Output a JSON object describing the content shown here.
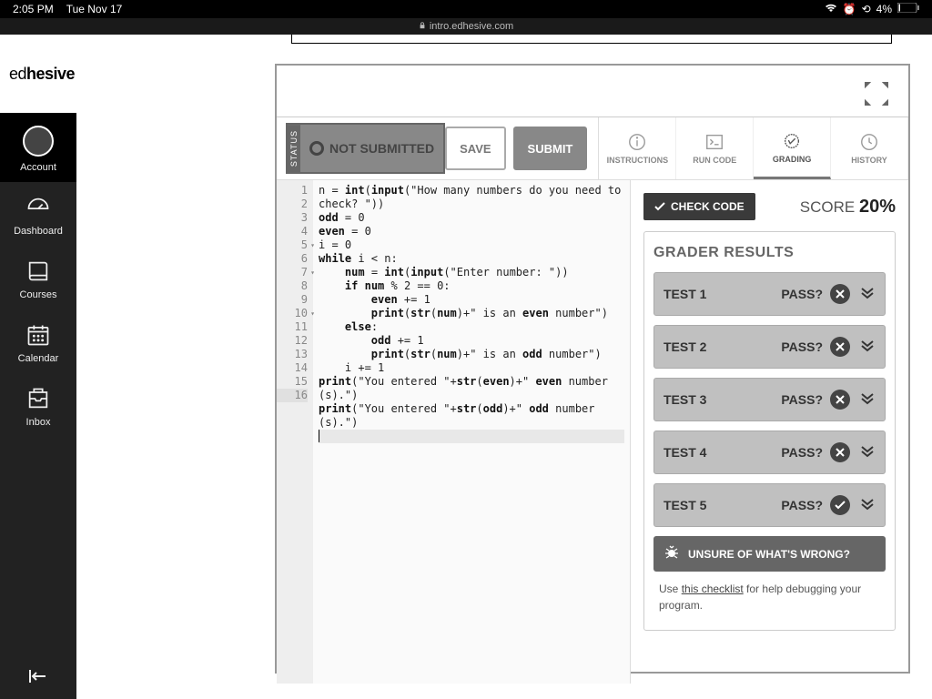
{
  "status_bar": {
    "time": "2:05 PM",
    "date": "Tue Nov 17",
    "battery": "4%"
  },
  "url_bar": {
    "host": "intro.edhesive.com"
  },
  "logo": {
    "a": "ed",
    "b": "hesive"
  },
  "sidebar": {
    "items": [
      {
        "label": "Account"
      },
      {
        "label": "Dashboard"
      },
      {
        "label": "Courses"
      },
      {
        "label": "Calendar"
      },
      {
        "label": "Inbox"
      }
    ]
  },
  "submission": {
    "status_label": "STATUS",
    "status_text": "NOT SUBMITTED",
    "save": "SAVE",
    "submit": "SUBMIT"
  },
  "tabs": {
    "instructions": "INSTRUCTIONS",
    "run": "RUN CODE",
    "grading": "GRADING",
    "history": "HISTORY"
  },
  "code": {
    "lines": [
      "n = int(input(\"How many numbers do you need to check? \"))",
      "odd = 0",
      "even = 0",
      "i = 0",
      "while i < n:",
      "    num = int(input(\"Enter number: \"))",
      "    if num % 2 == 0:",
      "        even += 1",
      "        print(str(num)+\" is an even number\")",
      "    else:",
      "        odd += 1",
      "        print(str(num)+\" is an odd number\")",
      "    i += 1",
      "print(\"You entered \"+str(even)+\" even number(s).\")",
      "print(\"You entered \"+str(odd)+\" odd number(s).\")",
      ""
    ]
  },
  "grader": {
    "check_code": "CHECK CODE",
    "score_label": "SCORE",
    "score_value": "20%",
    "results_title": "GRADER RESULTS",
    "tests": [
      {
        "name": "TEST 1",
        "label": "PASS?",
        "pass": false
      },
      {
        "name": "TEST 2",
        "label": "PASS?",
        "pass": false
      },
      {
        "name": "TEST 3",
        "label": "PASS?",
        "pass": false
      },
      {
        "name": "TEST 4",
        "label": "PASS?",
        "pass": false
      },
      {
        "name": "TEST 5",
        "label": "PASS?",
        "pass": true
      }
    ],
    "unsure": "UNSURE OF WHAT'S WRONG?",
    "hint_prefix": "Use ",
    "hint_link": "this checklist",
    "hint_suffix": " for help debugging your program."
  }
}
